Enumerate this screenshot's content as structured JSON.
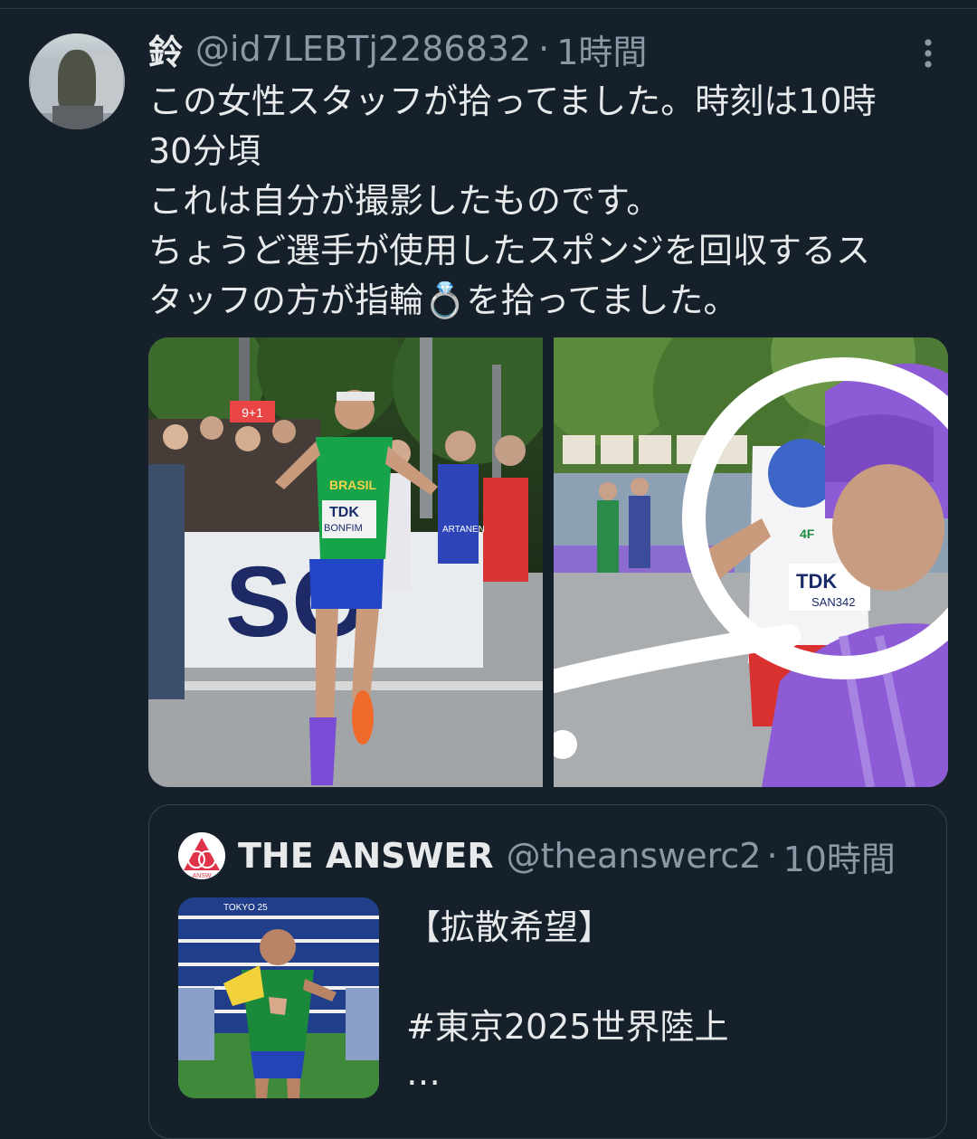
{
  "tweet": {
    "display_name": "鈴",
    "handle": "@id7LEBTj2286832",
    "separator": "·",
    "time": "1時間",
    "text_lines": [
      "この女性スタッフが拾ってました。時刻は10時",
      "30分頃",
      "これは自分が撮影したものです。",
      "ちょうど選手が使用したスポンジを回収するス",
      "タッフの方が指輪💍を拾ってました。"
    ],
    "media": {
      "left_photo": {
        "sign_fragment": "SO",
        "bib_brand": "TDK",
        "bib_name": "BONFIM",
        "jersey_text": "BRASIL",
        "top_sign": "9+1",
        "runner_bib": "ARTANEN"
      },
      "right_photo": {
        "bib_brand": "TDK",
        "bib_number": "SAN342",
        "jersey_brand": "4F"
      }
    }
  },
  "quote": {
    "display_name": "THE ANSWER",
    "handle": "@theanswerc2",
    "separator": "·",
    "time": "10時間",
    "avatar_label": "ANSW",
    "text_line1": "【拡散希望】",
    "text_line2": "#東京2025世界陸上",
    "text_line3": "…",
    "thumbnail_backdrop_text": "TOKYO 25"
  },
  "colors": {
    "background": "#15202b",
    "primary_text": "#e7e9ea",
    "secondary_text": "#8b98a5",
    "border": "#38444d"
  },
  "icons": {
    "more": "more-vertical-icon"
  }
}
